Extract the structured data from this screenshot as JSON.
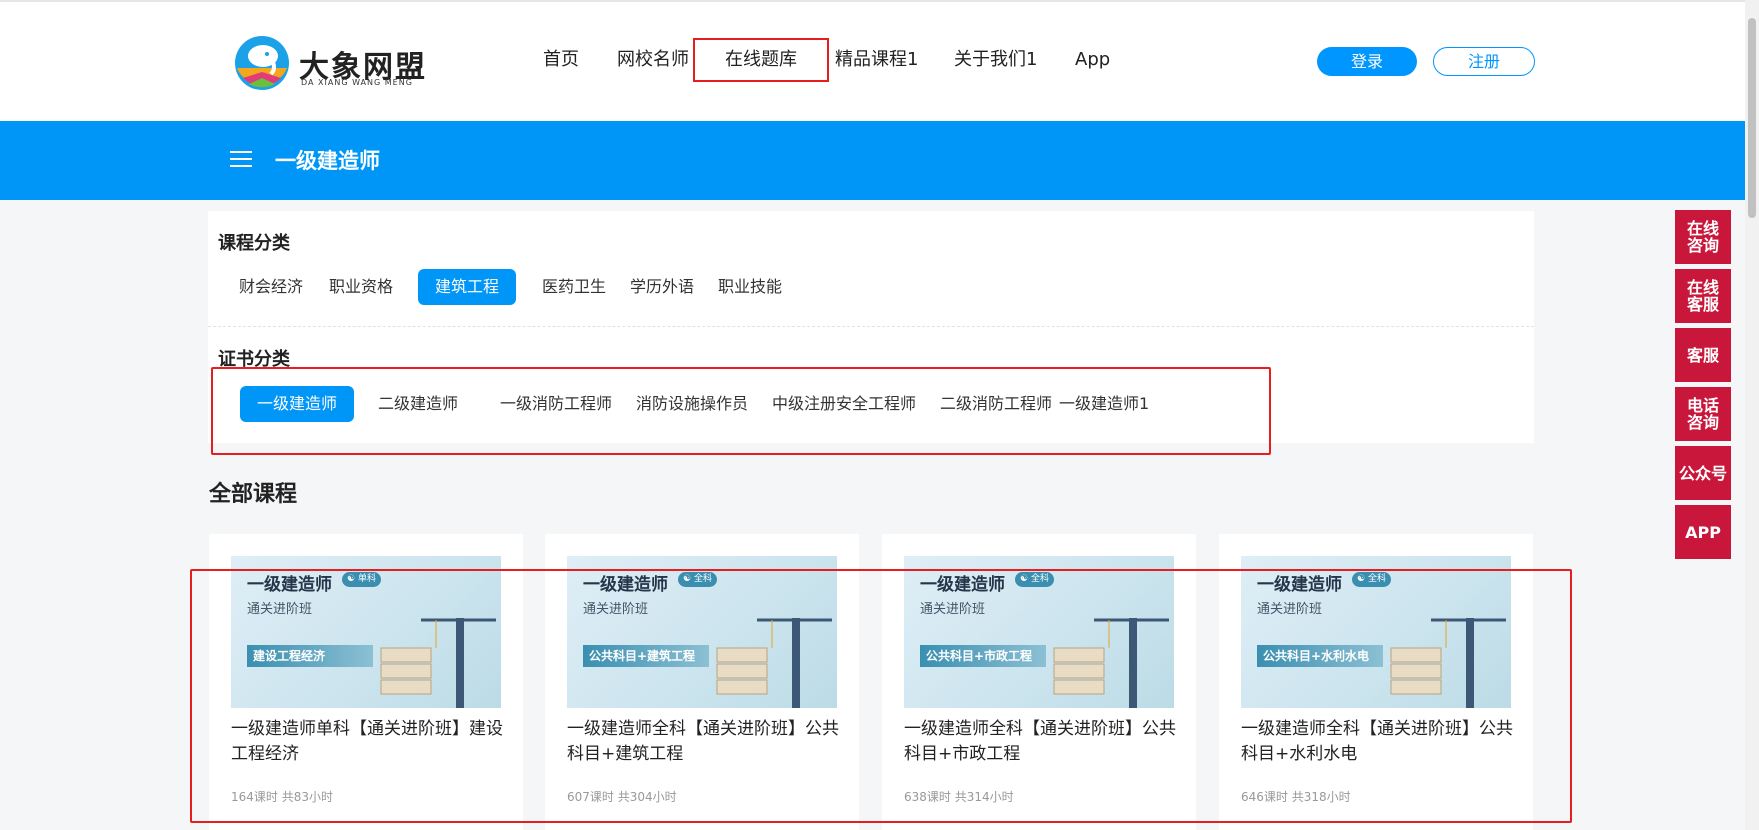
{
  "brand": {
    "name": "大象网盟",
    "subtitle": "DA XIANG WANG MENG"
  },
  "nav": {
    "items": [
      "首页",
      "网校名师",
      "在线题库",
      "精品课程1",
      "关于我们1",
      "App"
    ],
    "active_index": 2
  },
  "auth": {
    "login_label": "登录",
    "register_label": "注册"
  },
  "banner": {
    "title": "一级建造师"
  },
  "filters": {
    "course_category": {
      "title": "课程分类",
      "options": [
        "财会经济",
        "职业资格",
        "建筑工程",
        "医药卫生",
        "学历外语",
        "职业技能"
      ],
      "selected": "建筑工程"
    },
    "certificate_category": {
      "title": "证书分类",
      "options": [
        "一级建造师",
        "二级建造师",
        "一级消防工程师",
        "消防设施操作员",
        "中级注册安全工程师",
        "二级消防工程师",
        "一级建造师1"
      ],
      "selected": "一级建造师"
    }
  },
  "courses_section": {
    "title": "全部课程",
    "items": [
      {
        "thumb_title": "一级建造师",
        "thumb_tag": "单科",
        "thumb_subtitle": "通关进阶班",
        "thumb_band": "建设工程经济",
        "title": "一级建造师单科【通关进阶班】建设工程经济",
        "meta": "164课时 共83小时"
      },
      {
        "thumb_title": "一级建造师",
        "thumb_tag": "全科",
        "thumb_subtitle": "通关进阶班",
        "thumb_band": "公共科目+建筑工程",
        "title": "一级建造师全科【通关进阶班】公共科目+建筑工程",
        "meta": "607课时 共304小时"
      },
      {
        "thumb_title": "一级建造师",
        "thumb_tag": "全科",
        "thumb_subtitle": "通关进阶班",
        "thumb_band": "公共科目+市政工程",
        "title": "一级建造师全科【通关进阶班】公共科目+市政工程",
        "meta": "638课时 共314小时"
      },
      {
        "thumb_title": "一级建造师",
        "thumb_tag": "全科",
        "thumb_subtitle": "通关进阶班",
        "thumb_band": "公共科目+水利水电",
        "title": "一级建造师全科【通关进阶班】公共科目+水利水电",
        "meta": "646课时 共318小时"
      }
    ]
  },
  "side_widgets": [
    "在线\n咨询",
    "在线\n客服",
    "客服",
    "电话\n咨询",
    "公众号",
    "APP"
  ],
  "colors": {
    "primary": "#0096f8",
    "side_widget": "#c8173a",
    "highlight": "#e81d1d"
  }
}
